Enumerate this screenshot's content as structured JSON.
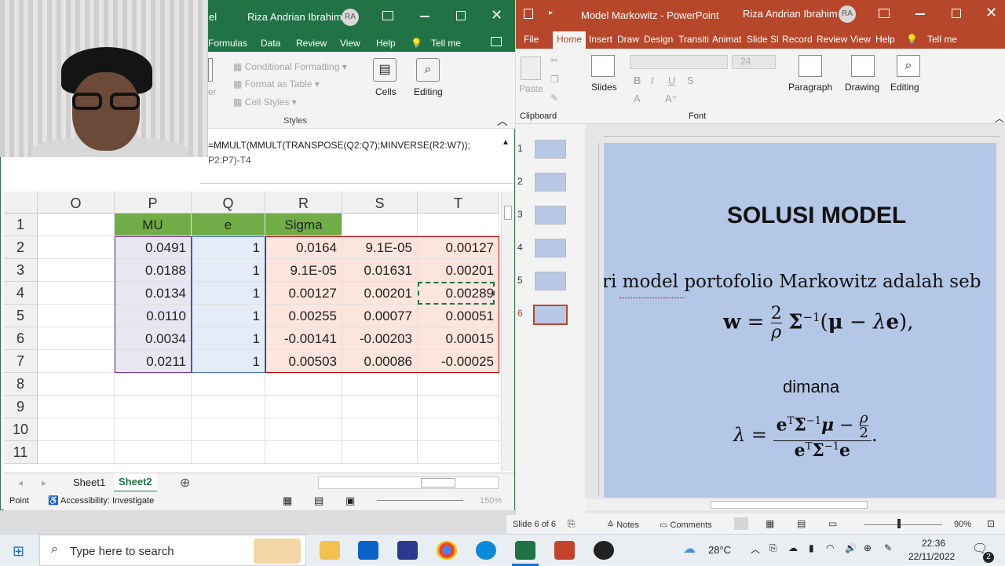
{
  "excel": {
    "title_fragment": "el",
    "user": "Riza Andrian Ibrahim",
    "user_initials": "RA",
    "tabs": [
      "Formulas",
      "Data",
      "Review",
      "View",
      "Help",
      "Tell me"
    ],
    "styles_group": [
      "Conditional Formatting",
      "Format as Table",
      "Cell Styles"
    ],
    "styles_label": "Styles",
    "cells_label": "Cells",
    "editing_label": "Editing",
    "partial_label": "er",
    "formula_line1": "=MMULT(MMULT(TRANSPOSE(Q2:Q7);MINVERSE(R2:W7));",
    "formula_line2": "P2:P7)-T4",
    "column_headers": [
      "O",
      "P",
      "Q",
      "R",
      "S",
      "T"
    ],
    "row_headers": [
      "1",
      "2",
      "3",
      "4",
      "5",
      "6",
      "7",
      "8",
      "9",
      "10",
      "11"
    ],
    "header_row": [
      "",
      "MU",
      "e",
      "Sigma",
      "",
      ""
    ],
    "rows": [
      [
        "",
        "0.0491",
        "1",
        "0.0164",
        "9.1E-05",
        "0.00127"
      ],
      [
        "",
        "0.0188",
        "1",
        "9.1E-05",
        "0.01631",
        "0.00201"
      ],
      [
        "",
        "0.0134",
        "1",
        "0.00127",
        "0.00201",
        "0.00289"
      ],
      [
        "",
        "0.0110",
        "1",
        "0.00255",
        "0.00077",
        "0.00051"
      ],
      [
        "",
        "0.0034",
        "1",
        "-0.00141",
        "-0.00203",
        "0.00015"
      ],
      [
        "",
        "0.0211",
        "1",
        "0.00503",
        "0.00086",
        "-0.00025"
      ]
    ],
    "sheets": [
      "Sheet1",
      "Sheet2"
    ],
    "active_sheet": "Sheet2",
    "status_mode": "Point",
    "accessibility": "Accessibility: Investigate",
    "zoom": "150%"
  },
  "ppt": {
    "title": "Model Markowitz - PowerPoint",
    "user": "Riza Andrian Ibrahim",
    "user_initials": "RA",
    "tabs": [
      "File",
      "Home",
      "Insert",
      "Draw",
      "Design",
      "Transiti",
      "Animat",
      "Slide Sl",
      "Record",
      "Review",
      "View",
      "Help",
      "Tell me"
    ],
    "active_tab": "Home",
    "groups": {
      "slides": "Slides",
      "clipboard": "Clipboard",
      "font": "Font",
      "paragraph": "Paragraph",
      "drawing": "Drawing",
      "editing": "Editing",
      "paste": "Paste"
    },
    "font_size": "24",
    "thumb_numbers": [
      "1",
      "2",
      "3",
      "4",
      "5",
      "6"
    ],
    "slide_title": "SOLUSI MODEL",
    "slide_line": "ri model portofolio Markowitz adalah seb",
    "slide_dimana": "dimana",
    "status_slide": "Slide 6 of 6",
    "notes": "Notes",
    "comments": "Comments",
    "zoom": "90%"
  },
  "taskbar": {
    "search_placeholder": "Type here to search",
    "temperature": "28°C",
    "time": "22:36",
    "date": "22/11/2022",
    "notif_count": "2"
  }
}
